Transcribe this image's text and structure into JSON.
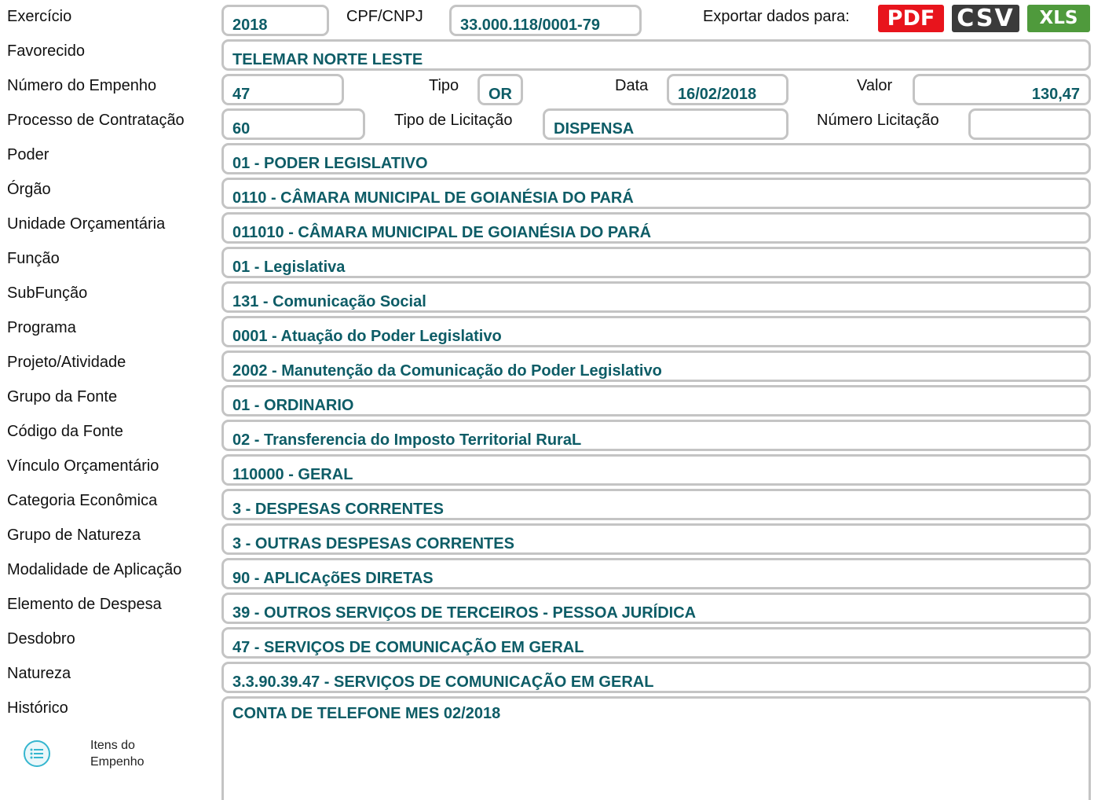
{
  "top": {
    "exercicio_label": "Exercício",
    "exercicio": "2018",
    "cpf_label": "CPF/CNPJ",
    "cpf": "33.000.118/0001-79",
    "export_label": "Exportar dados para:",
    "export": {
      "pdf": "PDF",
      "csv": "CSV",
      "xls": "XLS"
    }
  },
  "favorecido_label": "Favorecido",
  "favorecido": "TELEMAR NORTE LESTE",
  "empenho": {
    "numero_label": "Número do Empenho",
    "numero": "47",
    "tipo_label": "Tipo",
    "tipo": "OR",
    "data_label": "Data",
    "data": "16/02/2018",
    "valor_label": "Valor",
    "valor": "130,47"
  },
  "processo": {
    "label": "Processo de Contratação",
    "value": "60",
    "tipo_licitacao_label": "Tipo de Licitação",
    "tipo_licitacao": "DISPENSA",
    "numero_licitacao_label": "Número Licitação",
    "numero_licitacao": ""
  },
  "fields": [
    {
      "label": "Poder",
      "value": "01 - PODER LEGISLATIVO"
    },
    {
      "label": "Órgão",
      "value": "0110 - CÂMARA MUNICIPAL DE GOIANÉSIA DO PARÁ"
    },
    {
      "label": "Unidade Orçamentária",
      "value": "011010 - CÂMARA MUNICIPAL DE GOIANÉSIA DO PARÁ"
    },
    {
      "label": "Função",
      "value": "01 - Legislativa"
    },
    {
      "label": "SubFunção",
      "value": "131 - Comunicação Social"
    },
    {
      "label": "Programa",
      "value": "0001 - Atuação do Poder Legislativo"
    },
    {
      "label": "Projeto/Atividade",
      "value": "2002 - Manutenção da Comunicação do Poder Legislativo"
    },
    {
      "label": "Grupo da Fonte",
      "value": "01 - ORDINARIO"
    },
    {
      "label": "Código da Fonte",
      "value": "02 - Transferencia do Imposto Territorial RuraL"
    },
    {
      "label": "Vínculo Orçamentário",
      "value": "110000 - GERAL"
    },
    {
      "label": "Categoria Econômica",
      "value": "3 - DESPESAS CORRENTES"
    },
    {
      "label": "Grupo de Natureza",
      "value": "3 - OUTRAS DESPESAS CORRENTES"
    },
    {
      "label": "Modalidade de Aplicação",
      "value": "90 - APLICAçõES DIRETAS"
    },
    {
      "label": "Elemento de Despesa",
      "value": "39 - OUTROS SERVIÇOS DE TERCEIROS - PESSOA JURÍDICA"
    },
    {
      "label": "Desdobro",
      "value": "47 - SERVIÇOS DE COMUNICAÇÃO EM GERAL"
    },
    {
      "label": "Natureza",
      "value": "3.3.90.39.47 - SERVIÇOS DE COMUNICAÇÃO EM GERAL"
    }
  ],
  "historico_label": "Histórico",
  "historico": "CONTA DE TELEFONE MES 02/2018",
  "itens": {
    "line1": "Itens do",
    "line2": "Empenho",
    "icon": "list-icon"
  },
  "colors": {
    "value_text": "#0d5c66",
    "pdf": "#e8141c",
    "csv": "#3b3b3b",
    "xls": "#4f9a3c",
    "icon": "#35b6cf"
  }
}
